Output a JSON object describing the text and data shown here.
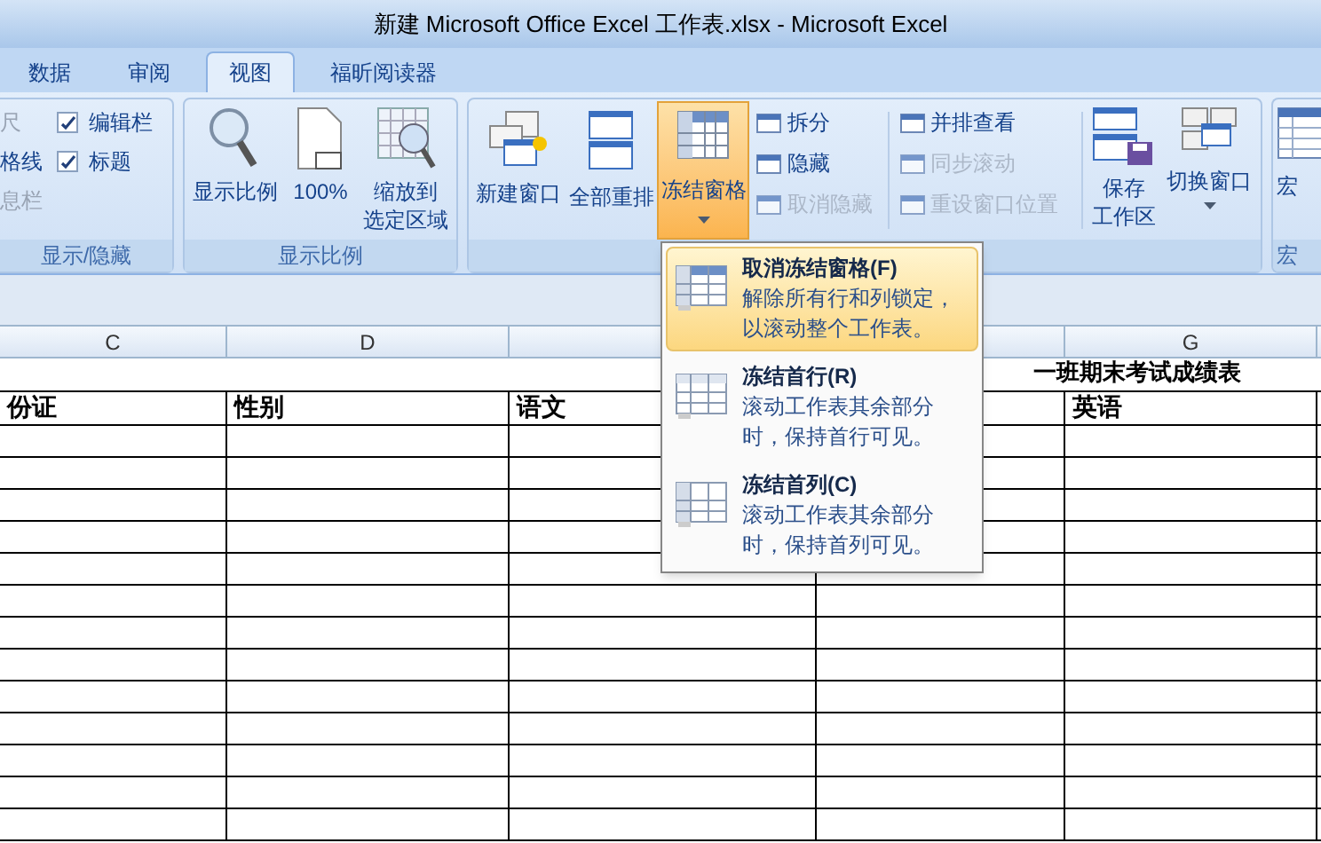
{
  "window": {
    "title": "新建 Microsoft Office Excel 工作表.xlsx - Microsoft Excel"
  },
  "tabs": [
    {
      "label": "数据",
      "selected": false
    },
    {
      "label": "审阅",
      "selected": false
    },
    {
      "label": "视图",
      "selected": true
    },
    {
      "label": "福昕阅读器",
      "selected": false
    }
  ],
  "show_hide": {
    "label": "显示/隐藏",
    "cut_items": [
      {
        "label": "尺",
        "disabled": true
      },
      {
        "label": "格线",
        "disabled": false
      },
      {
        "label": "息栏",
        "disabled": true
      }
    ],
    "checkboxes": [
      {
        "label": "编辑栏",
        "checked": true
      },
      {
        "label": "标题",
        "checked": true
      }
    ]
  },
  "zoom_group": {
    "label": "显示比例",
    "buttons": [
      {
        "kind": "magnifier",
        "label": [
          "显示比例"
        ]
      },
      {
        "kind": "page100",
        "label": [
          "100%"
        ]
      },
      {
        "kind": "zoomsel",
        "label": [
          "缩放到",
          "选定区域"
        ]
      }
    ]
  },
  "window_group": {
    "big_buttons": [
      {
        "kind": "newwin",
        "label": "新建窗口",
        "pressed": false,
        "dropdown": false
      },
      {
        "kind": "arrange",
        "label": "全部重排",
        "pressed": false,
        "dropdown": false
      },
      {
        "kind": "freeze",
        "label": "冻结窗格",
        "pressed": true,
        "dropdown": true
      }
    ],
    "small_col_1": [
      {
        "label": "拆分",
        "disabled": false
      },
      {
        "label": "隐藏",
        "disabled": false
      },
      {
        "label": "取消隐藏",
        "disabled": true
      }
    ],
    "small_col_2": [
      {
        "label": "并排查看",
        "disabled": false
      },
      {
        "label": "同步滚动",
        "disabled": true
      },
      {
        "label": "重设窗口位置",
        "disabled": true
      }
    ],
    "right_buttons": [
      {
        "kind": "save",
        "label": [
          "保存",
          "工作区"
        ],
        "dropdown": false
      },
      {
        "kind": "switch",
        "label": [
          "切换窗口"
        ],
        "dropdown": true
      }
    ]
  },
  "macro_group": {
    "label": "宏",
    "group_label": "宏"
  },
  "freeze_menu": [
    {
      "title": "取消冻结窗格(F)",
      "description": [
        "解除所有行和列锁定，",
        "以滚动整个工作表。"
      ],
      "selected": true
    },
    {
      "title": "冻结首行(R)",
      "description": [
        "滚动工作表其余部分",
        "时，保持首行可见。"
      ],
      "selected": false
    },
    {
      "title": "冻结首列(C)",
      "description": [
        "滚动工作表其余部分",
        "时，保持首列可见。"
      ],
      "selected": false
    }
  ],
  "sheet": {
    "title": "一班期末考试成绩表",
    "columns": [
      {
        "letter": "C",
        "header": "份证"
      },
      {
        "letter": "D",
        "header": "性别"
      },
      {
        "header": "语文"
      },
      {},
      {
        "letter": "G",
        "header": "英语"
      }
    ]
  }
}
